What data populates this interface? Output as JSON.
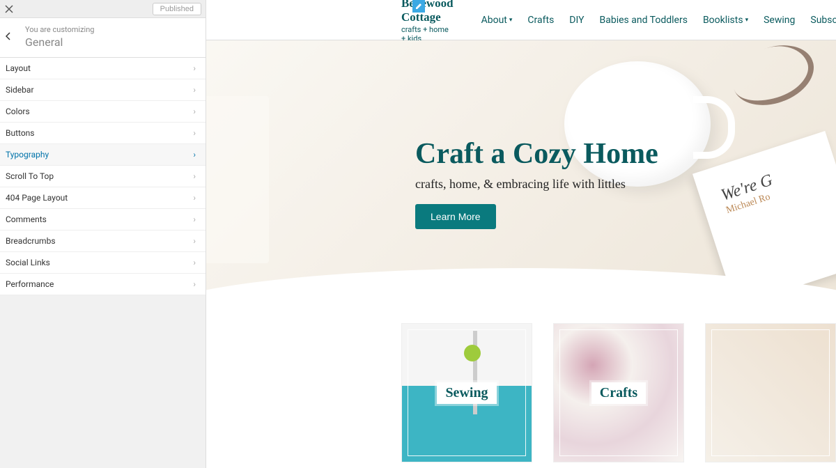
{
  "customizer": {
    "topbar": {
      "publish_label": "Published"
    },
    "header": {
      "customizing_label": "You are customizing",
      "section_title": "General"
    },
    "menu": [
      {
        "label": "Layout",
        "active": false
      },
      {
        "label": "Sidebar",
        "active": false
      },
      {
        "label": "Colors",
        "active": false
      },
      {
        "label": "Buttons",
        "active": false
      },
      {
        "label": "Typography",
        "active": true
      },
      {
        "label": "Scroll To Top",
        "active": false
      },
      {
        "label": "404 Page Layout",
        "active": false
      },
      {
        "label": "Comments",
        "active": false
      },
      {
        "label": "Breadcrumbs",
        "active": false
      },
      {
        "label": "Social Links",
        "active": false
      },
      {
        "label": "Performance",
        "active": false
      }
    ]
  },
  "site": {
    "logo": {
      "line1": "Bellewood",
      "line2": "Cottage",
      "tagline": "crafts + home + kids"
    },
    "nav": [
      {
        "label": "About",
        "dropdown": true
      },
      {
        "label": "Crafts",
        "dropdown": false
      },
      {
        "label": "DIY",
        "dropdown": false
      },
      {
        "label": "Babies and Toddlers",
        "dropdown": false
      },
      {
        "label": "Booklists",
        "dropdown": true
      },
      {
        "label": "Sewing",
        "dropdown": false
      },
      {
        "label": "Subscribe",
        "dropdown": false
      }
    ],
    "hero": {
      "title": "Craft a Cozy Home",
      "subtitle": "crafts, home, & embracing life with littles",
      "button": "Learn More",
      "book_title": "We're G",
      "book_author": "Michael Ro"
    },
    "cards": [
      {
        "label": "Sewing"
      },
      {
        "label": "Crafts"
      },
      {
        "label": ""
      }
    ]
  }
}
